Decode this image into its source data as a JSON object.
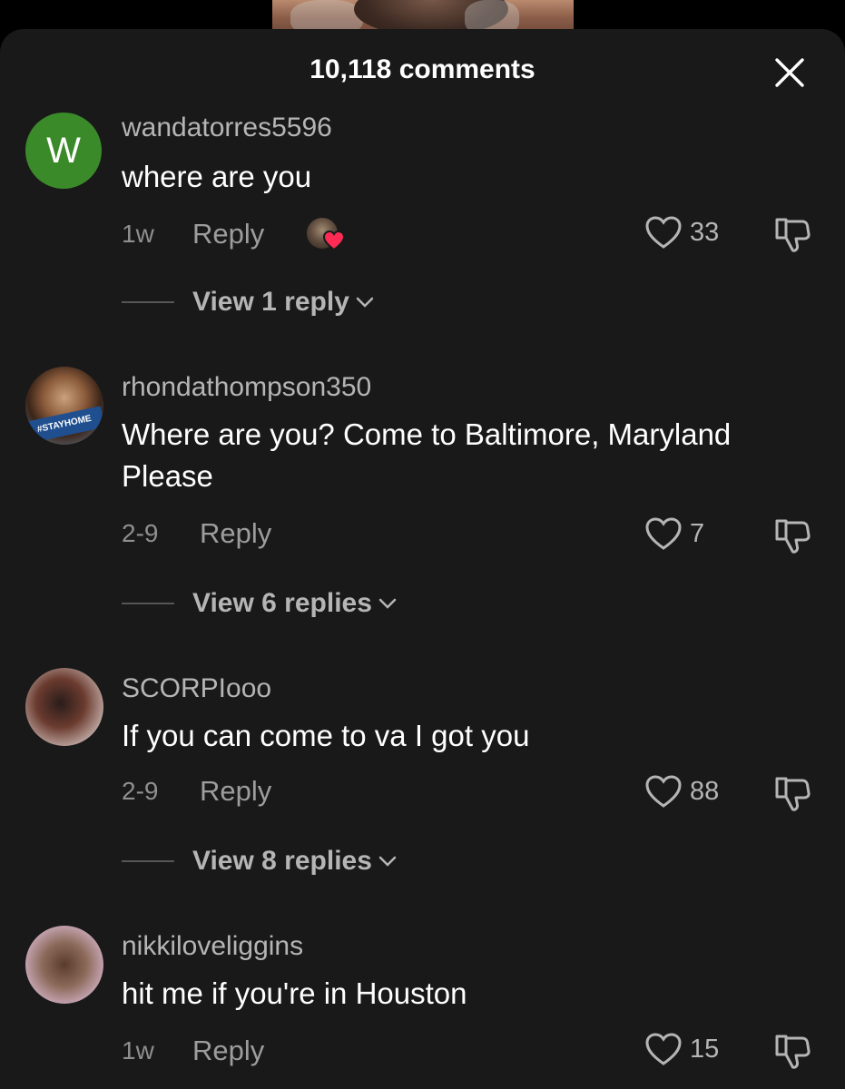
{
  "header": {
    "title": "10,118 comments"
  },
  "comments": [
    {
      "avatar_letter": "W",
      "username": "wandatorres5596",
      "text": "where are you",
      "time": "1w",
      "reply_label": "Reply",
      "likes": "33",
      "view_replies": "View 1 reply"
    },
    {
      "avatar_text": "#STAYHOME",
      "username": "rhondathompson350",
      "text": "Where are you? Come to Baltimore, Maryland Please",
      "time": "2-9",
      "reply_label": "Reply",
      "likes": "7",
      "view_replies": "View 6 replies"
    },
    {
      "username": "SCORPIooo",
      "text": "If you can come to va I got you",
      "time": "2-9",
      "reply_label": "Reply",
      "likes": "88",
      "view_replies": "View 8 replies"
    },
    {
      "username": "nikkiloveliggins",
      "text": "hit me if you're in Houston",
      "time": "1w",
      "reply_label": "Reply",
      "likes": "15"
    }
  ],
  "colors": {
    "background": "#191919",
    "avatar_green": "#3b8a2a",
    "heart_red": "#fe2c55",
    "muted_text": "#b5b5b5"
  },
  "icons": [
    "close-icon",
    "heart-outline-icon",
    "dislike-icon",
    "chevron-down-icon",
    "creator-liked-heart-icon"
  ]
}
